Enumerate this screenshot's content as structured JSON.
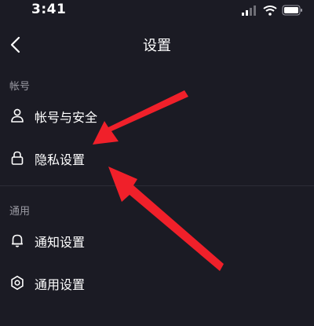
{
  "status_bar": {
    "time": "3:41"
  },
  "nav": {
    "title": "设置",
    "back_icon": "chevron-left-icon"
  },
  "sections": [
    {
      "header": "帐号",
      "items": [
        {
          "label": "帐号与安全",
          "icon": "person-icon"
        },
        {
          "label": "隐私设置",
          "icon": "lock-icon"
        }
      ]
    },
    {
      "header": "通用",
      "items": [
        {
          "label": "通知设置",
          "icon": "bell-icon"
        },
        {
          "label": "通用设置",
          "icon": "gear-icon"
        }
      ]
    }
  ],
  "annotation": {
    "arrow_color": "#f0202a",
    "arrow_count": 2
  }
}
